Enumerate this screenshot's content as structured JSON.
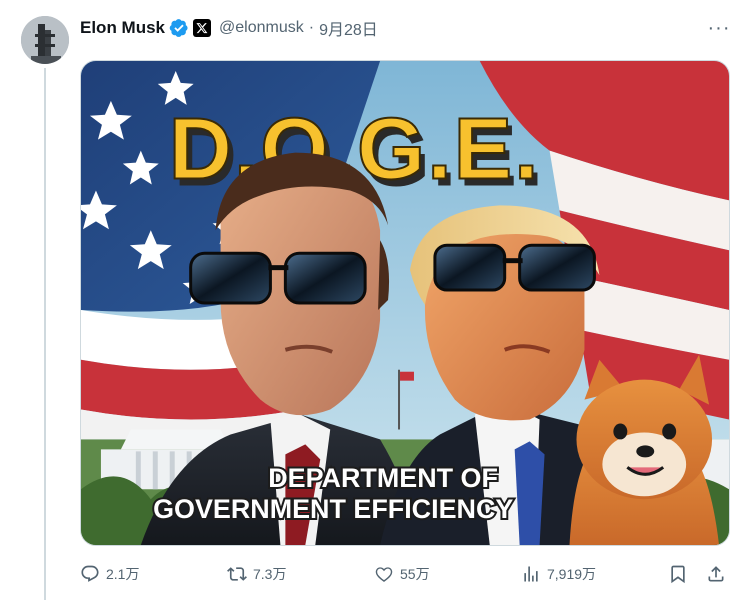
{
  "tweet": {
    "author_name": "Elon Musk",
    "author_handle": "@elonmusk",
    "separator": "·",
    "date": "9月28日",
    "more_label": "···"
  },
  "media": {
    "headline": "D.O.G.E.",
    "caption_line1": "DEPARTMENT OF",
    "caption_line2": "GOVERNMENT EFFICIENCY"
  },
  "actions": {
    "reply_count": "2.1万",
    "retweet_count": "7.3万",
    "like_count": "55万",
    "view_count": "7,919万"
  },
  "icons": {
    "verified": "verified-badge-icon",
    "affiliate": "x-logo-icon",
    "reply": "reply-icon",
    "retweet": "retweet-icon",
    "like": "heart-icon",
    "views": "analytics-icon",
    "bookmark": "bookmark-icon",
    "share": "share-icon"
  },
  "colors": {
    "verified_blue": "#1d9bf0",
    "text_secondary": "#536471",
    "doge_yellow": "#f7c12e"
  }
}
